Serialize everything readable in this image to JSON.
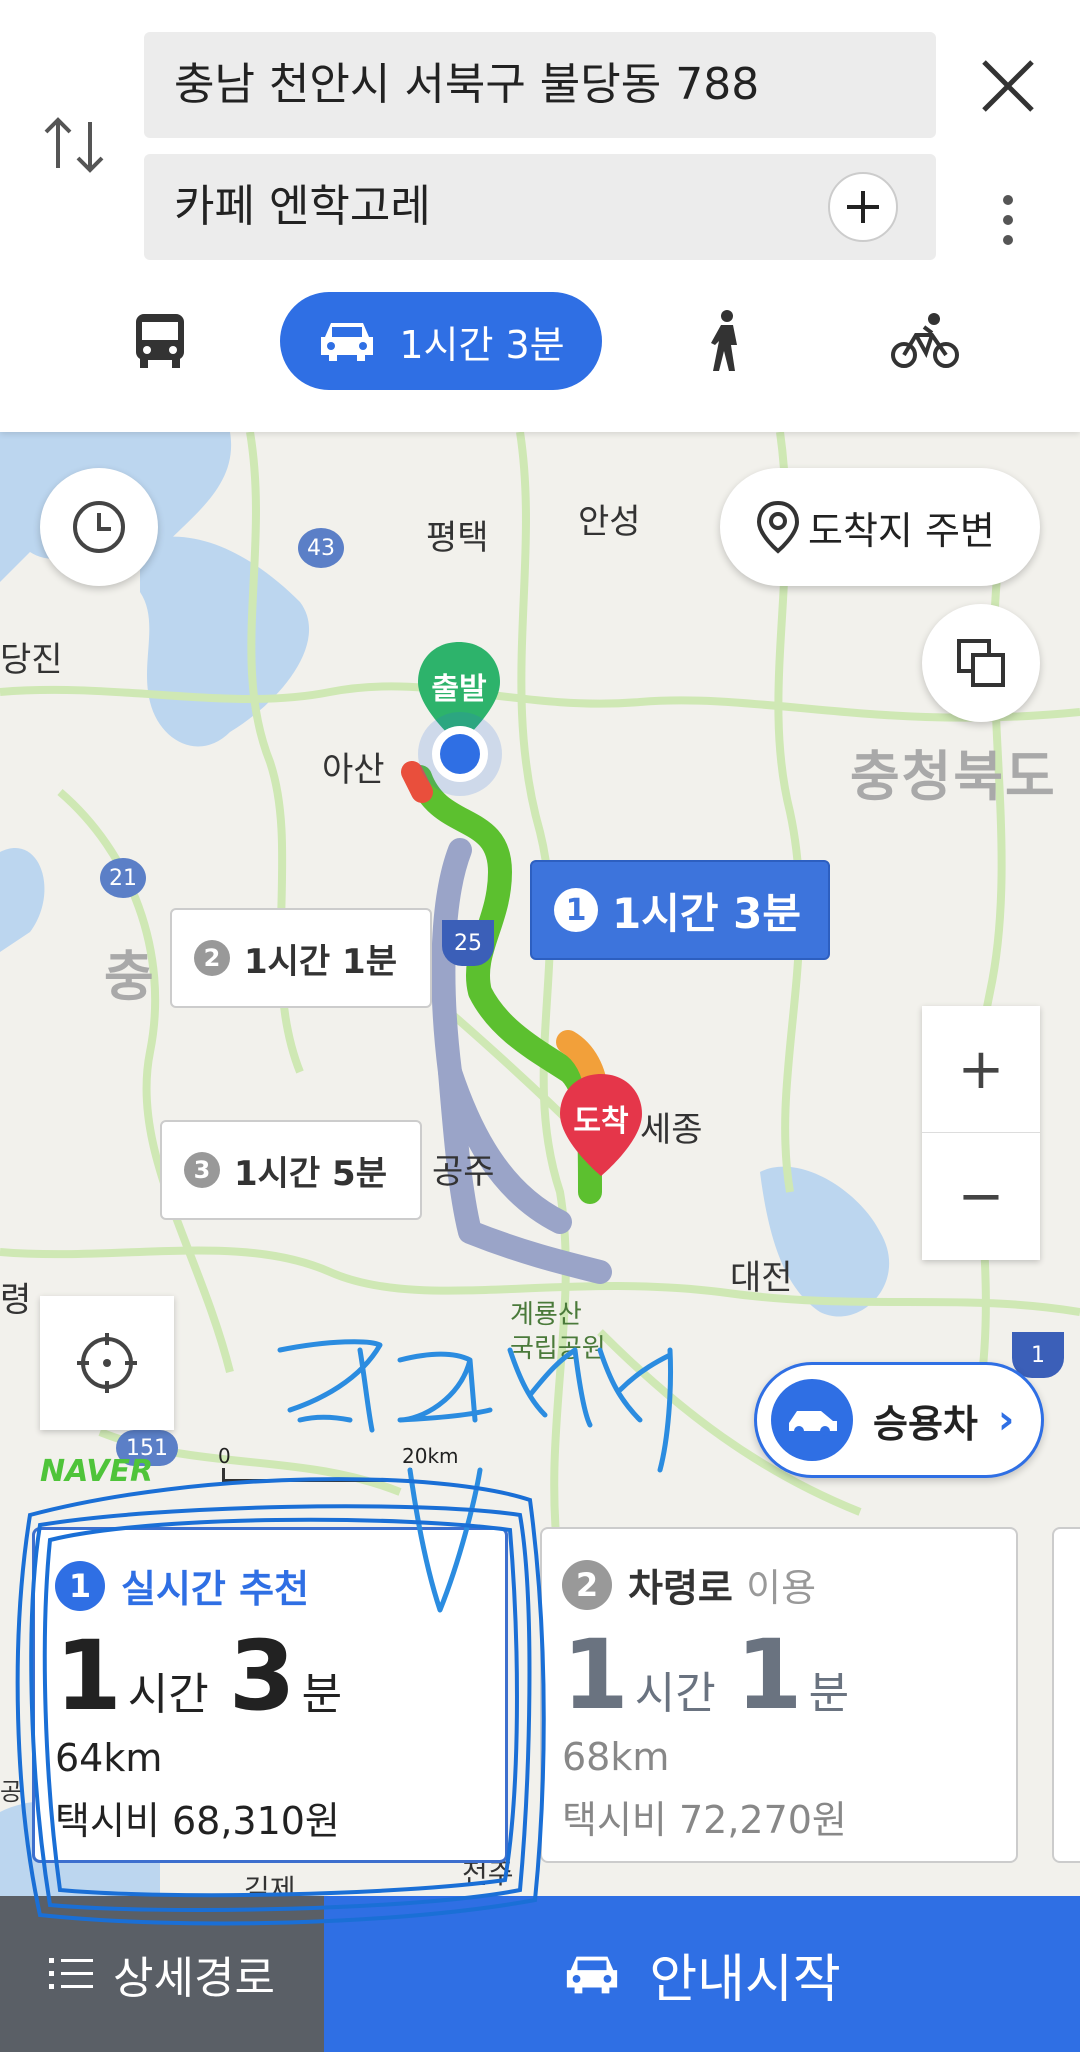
{
  "header": {
    "origin": "충남 천안시 서북구 불당동 788",
    "destination": "카페 엔학고레",
    "modes": [
      {
        "name": "bus",
        "icon": "bus-icon"
      },
      {
        "name": "car",
        "icon": "car-icon",
        "label": "1시간 3분",
        "selected": true
      },
      {
        "name": "walk",
        "icon": "walk-icon"
      },
      {
        "name": "bike",
        "icon": "bike-icon"
      }
    ]
  },
  "map": {
    "place_labels": {
      "pyeongtaek": "평택",
      "anseong": "안성",
      "dangjin": "당진",
      "asan": "아산",
      "chungbuk": "충청북도",
      "chungnam": "충",
      "sejong": "세종",
      "gongju": "공주",
      "daejeon": "대전",
      "ryeong": "령",
      "gyeryong": "계룡산",
      "park": "국립공원",
      "gimje": "김제",
      "jeonju": "전주",
      "gyeong": "공"
    },
    "road_shields": {
      "r43": "43",
      "r21": "21",
      "r25": "25",
      "r151": "151",
      "r1": "1"
    },
    "around_destination": "도착지 주변",
    "start_pin": "출발",
    "end_pin": "도착",
    "route_bubbles": [
      {
        "num": "1",
        "label": "1시간 3분",
        "selected": true
      },
      {
        "num": "2",
        "label": "1시간 1분"
      },
      {
        "num": "3",
        "label": "1시간 5분"
      }
    ],
    "vehicle": "승용차",
    "logo": "NAVER",
    "scale": {
      "zero": "0",
      "distance": "20km"
    },
    "zoom_in": "+",
    "zoom_out": "−",
    "colors": {
      "route_main": "#5cc02f",
      "route_alt": "#9aa4c8",
      "accent": "#2f6fe4",
      "dest": "#e5364a",
      "start": "#2db36b"
    }
  },
  "routes": [
    {
      "num": "1",
      "title": "실시간 추천",
      "title_suffix": "",
      "hours": "1",
      "hour_unit": "시간",
      "mins": "3",
      "min_unit": "분",
      "distance": "64km",
      "fare": "택시비 68,310원"
    },
    {
      "num": "2",
      "title": "차령로",
      "title_suffix": "이용",
      "hours": "1",
      "hour_unit": "시간",
      "mins": "1",
      "min_unit": "분",
      "distance": "68km",
      "fare": "택시비 72,270원"
    }
  ],
  "annotation": {
    "text": "경로선택"
  },
  "bottom": {
    "detail": "상세경로",
    "start": "안내시작"
  }
}
